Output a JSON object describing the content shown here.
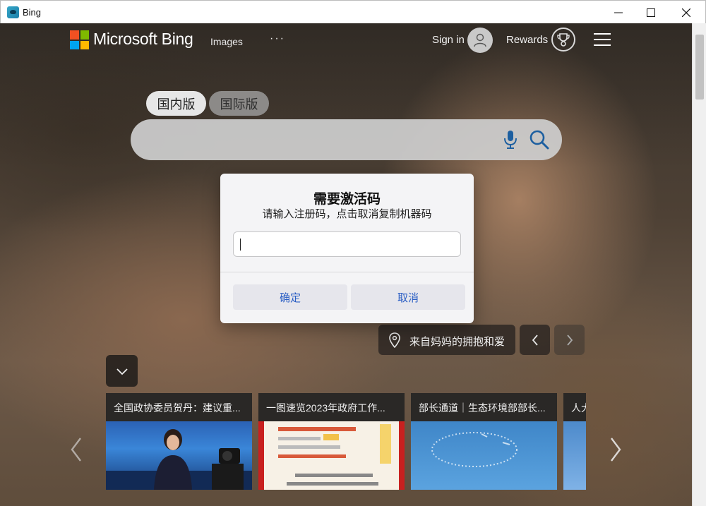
{
  "window": {
    "title": "Bing"
  },
  "header": {
    "brand": "Microsoft Bing",
    "nav_images": "Images",
    "nav_more": "···",
    "sign_in": "Sign in",
    "rewards": "Rewards",
    "logo_colors": [
      "#f25022",
      "#7fba00",
      "#00a4ef",
      "#ffb900"
    ]
  },
  "region_tabs": [
    {
      "label": "国内版",
      "selected": true
    },
    {
      "label": "国际版",
      "selected": false
    }
  ],
  "search": {
    "value": ""
  },
  "image_info": {
    "location_text": "来自妈妈的拥抱和爱"
  },
  "news": [
    {
      "title": "全国政协委员贺丹：建议重..."
    },
    {
      "title": "一图速览2023年政府工作..."
    },
    {
      "title": "部长通道｜生态环境部部长..."
    },
    {
      "title": "人大"
    }
  ],
  "dialog": {
    "title": "需要激活码",
    "message": "请输入注册码，点击取消复制机器码",
    "input_value": "",
    "ok_label": "确定",
    "cancel_label": "取消",
    "button_text_color": "#2a5ec4"
  }
}
